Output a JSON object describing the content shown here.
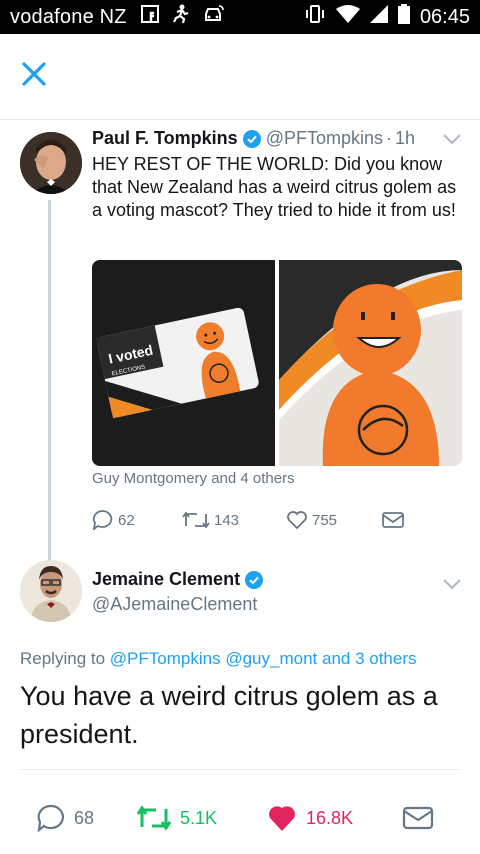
{
  "status_bar": {
    "carrier": "vodafone NZ",
    "time": "06:45"
  },
  "tweet": {
    "author_name": "Paul F. Tompkins",
    "author_handle": "@PFTompkins",
    "separator": "·",
    "age": "1h",
    "text": "HEY REST OF THE WORLD: Did you know that New Zealand has a weird citrus golem as a voting mascot? They tried to hide it from us!",
    "media_sticker_text": "I voted",
    "media_sticker_subtext": "ELECTIONS",
    "tagged": "Guy Montgomery and 4 others",
    "replies": "62",
    "retweets": "143",
    "likes": "755"
  },
  "reply": {
    "author_name": "Jemaine Clement",
    "author_handle": "@AJemaineClement",
    "replying_prefix": "Replying to",
    "replying_to_1": "@PFTompkins",
    "replying_to_2": "@guy_mont",
    "replying_suffix": "and 3 others",
    "text": "You have a weird citrus golem as a president.",
    "replies": "68",
    "retweets": "5.1K",
    "likes": "16.8K"
  },
  "colors": {
    "accent": "#1da1f2",
    "retweet_active": "#17bf63",
    "like_active": "#e0245e",
    "secondary_text": "#657786"
  }
}
